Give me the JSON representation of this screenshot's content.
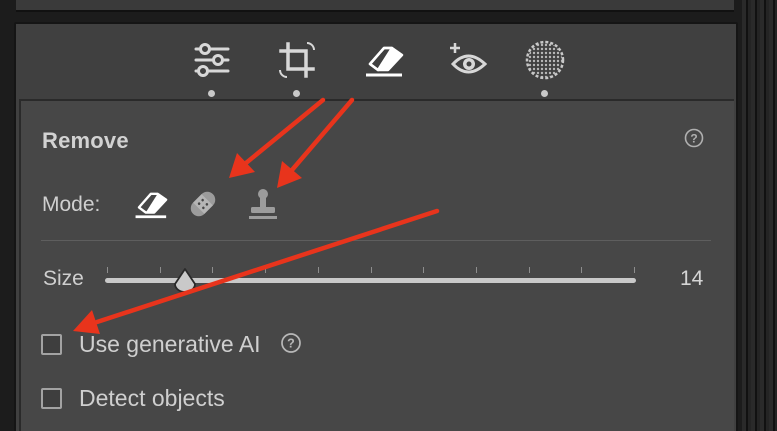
{
  "toolbar": {
    "tools": [
      {
        "name": "Edit",
        "icon": "sliders-icon",
        "has_indicator": true
      },
      {
        "name": "Crop",
        "icon": "crop-rotate-icon",
        "has_indicator": true
      },
      {
        "name": "Remove",
        "icon": "eraser-icon",
        "has_indicator": false,
        "active": true
      },
      {
        "name": "Red Eye",
        "icon": "red-eye-icon",
        "has_indicator": false
      },
      {
        "name": "Masking",
        "icon": "masking-circle-icon",
        "has_indicator": true
      }
    ]
  },
  "panel": {
    "title": "Remove",
    "help_icon": "help-circle-icon",
    "mode": {
      "label": "Mode:",
      "options": [
        {
          "name": "Remove",
          "icon": "eraser-icon",
          "selected": true
        },
        {
          "name": "Heal",
          "icon": "bandage-icon",
          "selected": false
        },
        {
          "name": "Clone",
          "icon": "stamp-icon",
          "selected": false
        }
      ]
    },
    "size": {
      "label": "Size",
      "value": "14",
      "slider_fraction": 0.15,
      "tick_count": 11
    },
    "options": [
      {
        "label": "Use generative AI",
        "checked": false,
        "has_help": true
      },
      {
        "label": "Detect objects",
        "checked": false,
        "has_help": false
      }
    ]
  },
  "annotations": {
    "arrow_color": "#e8341c",
    "count": 3
  },
  "colors": {
    "panel_bg": "#474747",
    "toolbar_bg": "#404040",
    "text": "#cfcfcf",
    "icon": "#d8d8d8"
  }
}
